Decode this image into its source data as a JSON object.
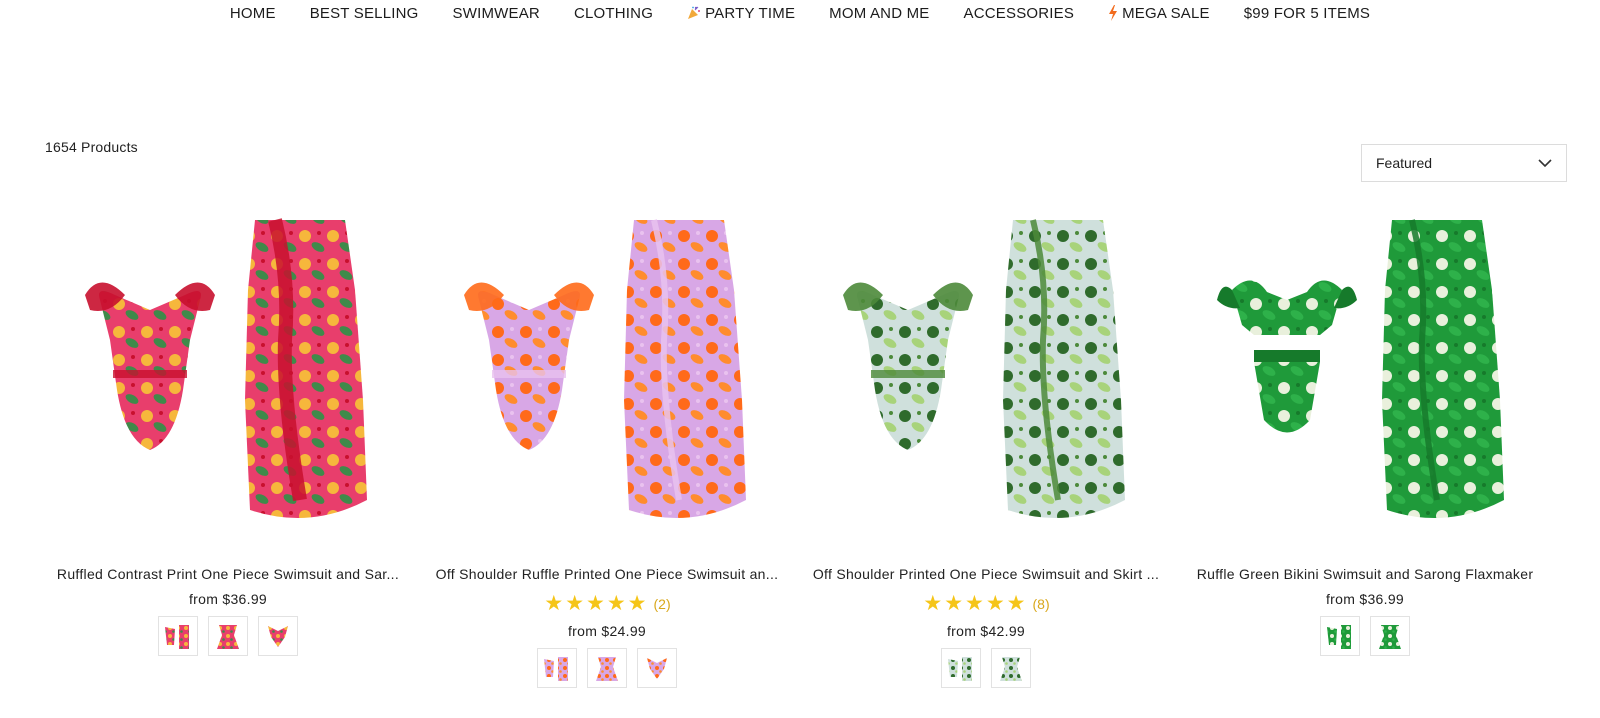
{
  "nav": {
    "items": [
      {
        "label": "HOME"
      },
      {
        "label": "BEST SELLING"
      },
      {
        "label": "SWIMWEAR"
      },
      {
        "label": "CLOTHING"
      },
      {
        "label": "PARTY TIME",
        "icon": "party-popper-icon"
      },
      {
        "label": "MOM AND ME"
      },
      {
        "label": "ACCESSORIES"
      },
      {
        "label": "MEGA SALE",
        "icon": "lightning-bolt-icon"
      },
      {
        "label": "$99 FOR 5 ITEMS"
      }
    ]
  },
  "toolbar": {
    "product_count": "1654 Products",
    "sort_selected": "Featured",
    "sort_icon": "chevron-down-icon"
  },
  "products": [
    {
      "title": "Ruffled Contrast Print One Piece Swimsuit and Sar...",
      "price": "from $36.99",
      "rating": null,
      "palette": {
        "base": "#e83e6c",
        "accent": "#f6b73c",
        "leaf": "#3f8a4a",
        "trim": "#c8102e"
      },
      "swatch_count": 3
    },
    {
      "title": "Off Shoulder Ruffle Printed One Piece Swimsuit an...",
      "price": "from $24.99",
      "rating": {
        "stars": 5,
        "count": "(2)"
      },
      "palette": {
        "base": "#d8a7e6",
        "accent": "#ff6a1a",
        "leaf": "#ff8c2e",
        "trim": "#e9c2ef"
      },
      "swatch_count": 3
    },
    {
      "title": "Off Shoulder Printed One Piece Swimsuit and Skirt ...",
      "price": "from $42.99",
      "rating": {
        "stars": 5,
        "count": "(8)"
      },
      "palette": {
        "base": "#cfe0dc",
        "accent": "#2f6b2c",
        "leaf": "#a8d37a",
        "trim": "#4c8a3a"
      },
      "swatch_count": 2
    },
    {
      "title": "Ruffle Green Bikini Swimsuit and Sarong Flaxmaker",
      "price": "from $36.99",
      "rating": null,
      "palette": {
        "base": "#1f9a3a",
        "accent": "#e9f0dc",
        "leaf": "#2eb14a",
        "trim": "#167a2b"
      },
      "swatch_count": 2
    }
  ],
  "colors": {
    "star": "#f5c518",
    "rating_count": "#d9a81c",
    "border": "#dcdcdc"
  }
}
